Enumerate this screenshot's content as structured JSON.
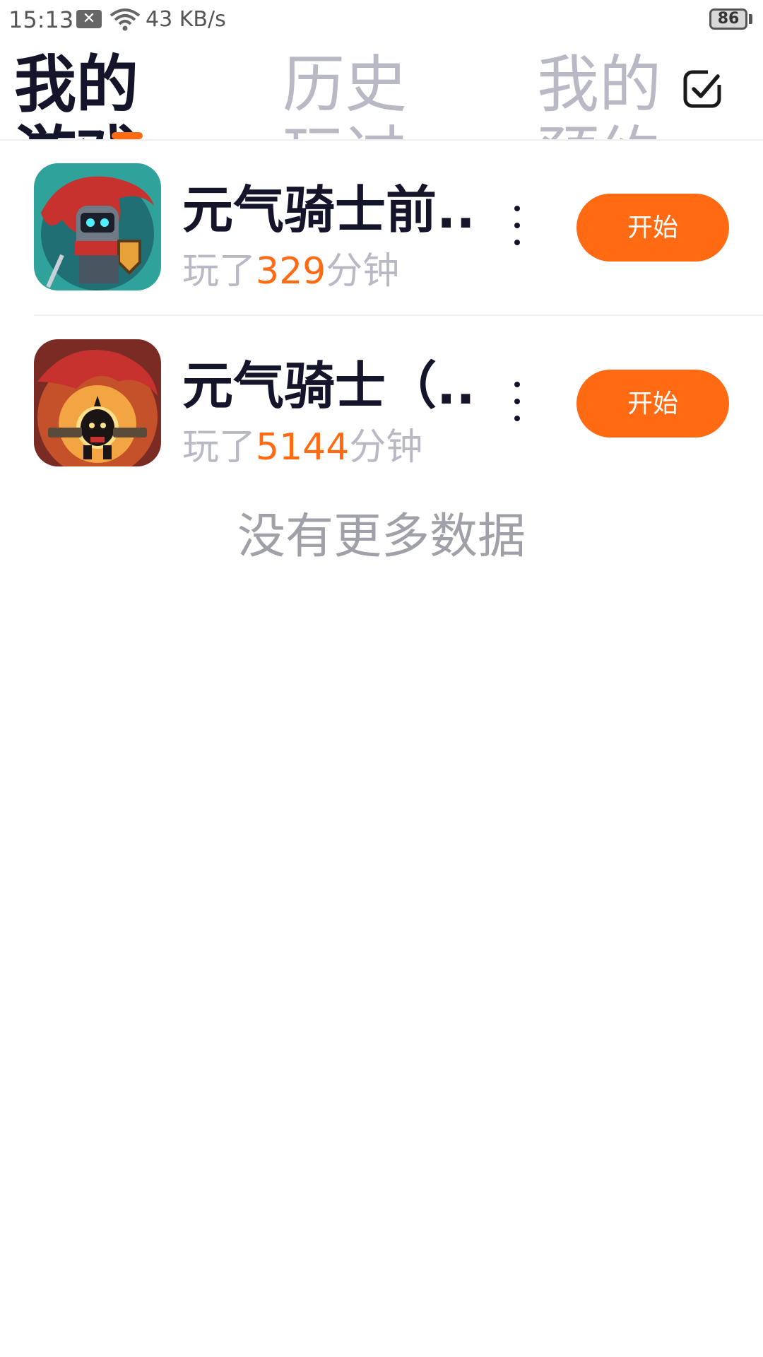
{
  "status_bar": {
    "time": "15:13",
    "notification_icon": "close-box-icon",
    "net_speed": "43 KB/s",
    "battery": "86"
  },
  "tabs": [
    {
      "label": "我的游戏",
      "active": true
    },
    {
      "label": "历史玩过",
      "active": false
    },
    {
      "label": "我的预约",
      "active": false
    }
  ],
  "accent_color": "#ff6a13",
  "games": [
    {
      "title": "元气骑士前...",
      "played_prefix": "玩了",
      "played_minutes": "329",
      "played_suffix": "分钟",
      "button": "开始"
    },
    {
      "title": "元气骑士（...",
      "played_prefix": "玩了",
      "played_minutes": "5144",
      "played_suffix": "分钟",
      "button": "开始"
    }
  ],
  "footer": {
    "no_more": "没有更多数据"
  }
}
